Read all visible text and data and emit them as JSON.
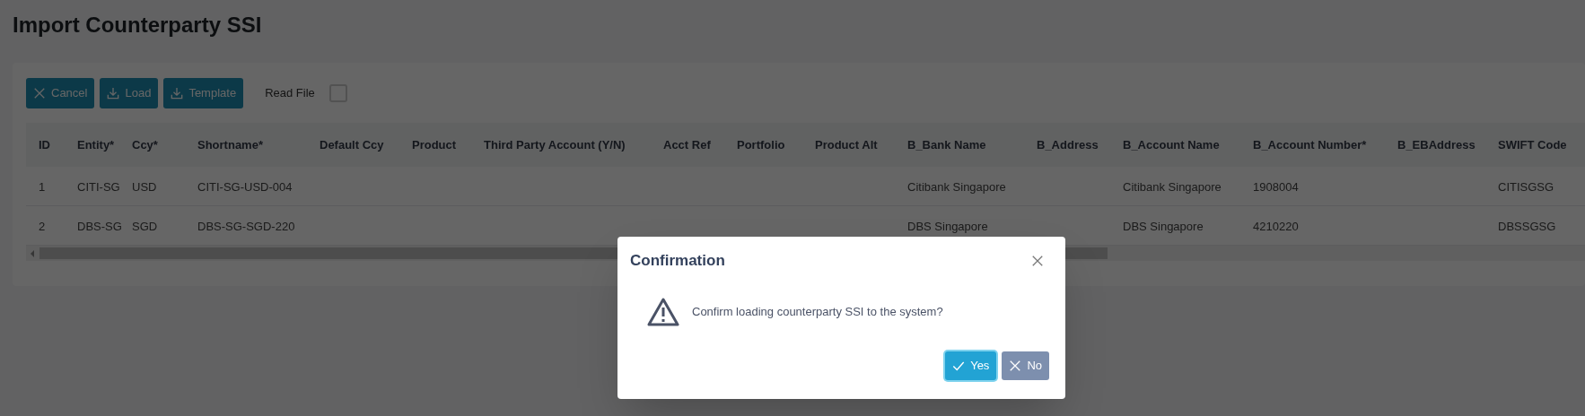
{
  "page": {
    "title": "Import Counterparty SSI"
  },
  "toolbar": {
    "buttons": [
      {
        "label": "Cancel",
        "kind": "cancel"
      },
      {
        "label": "Load",
        "kind": "download"
      },
      {
        "label": "Template",
        "kind": "download"
      }
    ],
    "read_file": {
      "label": "Read File",
      "checked": false
    }
  },
  "table": {
    "columns": [
      "ID",
      "Entity*",
      "Ccy*",
      "Shortname*",
      "Default Ccy",
      "Product",
      "Third Party Account (Y/N)",
      "Acct Ref",
      "Portfolio",
      "Product Alt",
      "B_Bank Name",
      "B_Address",
      "B_Account Name",
      "B_Account Number*",
      "B_EBAddress",
      "SWIFT Code"
    ],
    "rows": [
      [
        "1",
        "CITI-SG",
        "USD",
        "CITI-SG-USD-004",
        "",
        "",
        "",
        "",
        "",
        "",
        "Citibank Singapore",
        "",
        "Citibank Singapore",
        "1908004",
        "",
        "CITISGSG"
      ],
      [
        "2",
        "DBS-SG",
        "SGD",
        "DBS-SG-SGD-220",
        "",
        "",
        "",
        "",
        "",
        "",
        "DBS Singapore",
        "",
        "DBS Singapore",
        "4210220",
        "",
        "DBSSGSG"
      ]
    ]
  },
  "dialog": {
    "title": "Confirmation",
    "message": "Confirm loading counterparty SSI to the system?",
    "buttons": [
      {
        "label": "Yes",
        "kind": "confirm",
        "focused": true
      },
      {
        "label": "No",
        "kind": "cancel",
        "focused": false
      }
    ]
  }
}
